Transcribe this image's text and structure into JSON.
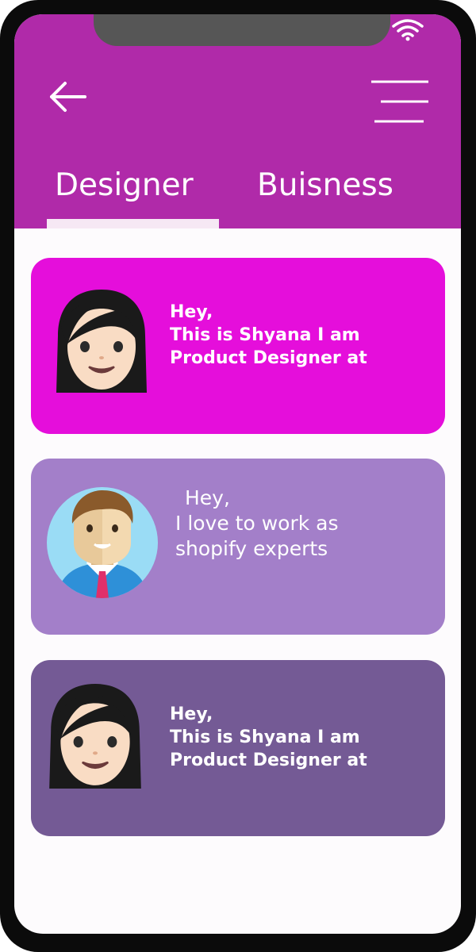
{
  "colors": {
    "header": "#b02aa9",
    "tab_indicator": "#f6e8f4",
    "card_magenta": "#e50edb",
    "card_lavender": "#a37fc9",
    "card_purple": "#745a95",
    "screen_background": "#fdfbfd",
    "text": "#ffffff"
  },
  "status_bar": {
    "icons": [
      "wifi-icon"
    ]
  },
  "header": {
    "back_icon": "arrow-left-icon",
    "menu_icon": "hamburger-menu-icon",
    "tabs": [
      {
        "label": "Designer",
        "active": true
      },
      {
        "label": "Buisness",
        "active": false
      }
    ]
  },
  "cards": [
    {
      "avatar": "woman-avatar-icon",
      "lines": [
        "Hey,",
        "This is Shyana I am",
        "Product Designer at"
      ]
    },
    {
      "avatar": "man-avatar-icon",
      "lines": [
        "Hey,",
        "I love to work as",
        "shopify experts"
      ]
    },
    {
      "avatar": "woman-avatar-icon",
      "lines": [
        "Hey,",
        "This is Shyana I am",
        "Product Designer at"
      ]
    }
  ]
}
